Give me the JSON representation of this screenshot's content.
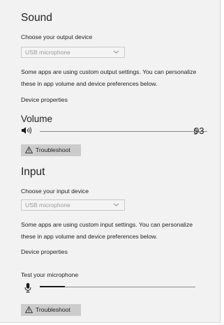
{
  "sound": {
    "title": "Sound",
    "output_label": "Choose your output device",
    "output_device": "USB microphone",
    "info_line1": "Some apps are using custom output settings. You can personalize",
    "info_line2": "these in app volume and device preferences below.",
    "device_properties": "Device properties",
    "volume_label": "Volume",
    "volume_value": "93",
    "volume_level_percent": 93,
    "troubleshoot_label": "Troubleshoot"
  },
  "input": {
    "title": "Input",
    "input_label": "Choose your input device",
    "input_device": "USB microphone",
    "info_line1": "Some apps are using custom input settings. You can personalize",
    "info_line2": "these in app volume and device preferences below.",
    "device_properties": "Device properties",
    "test_label": "Test your microphone",
    "mic_level_percent": 16,
    "troubleshoot_label": "Troubleshoot"
  },
  "icons": {
    "speaker": "speaker-icon",
    "microphone": "microphone-icon",
    "chevron": "chevron-down-icon",
    "warning": "warning-icon"
  },
  "colors": {
    "panel_background": "#f2f2f2",
    "button_background": "#cccccc",
    "meter_fill": "#1a1a1a"
  }
}
